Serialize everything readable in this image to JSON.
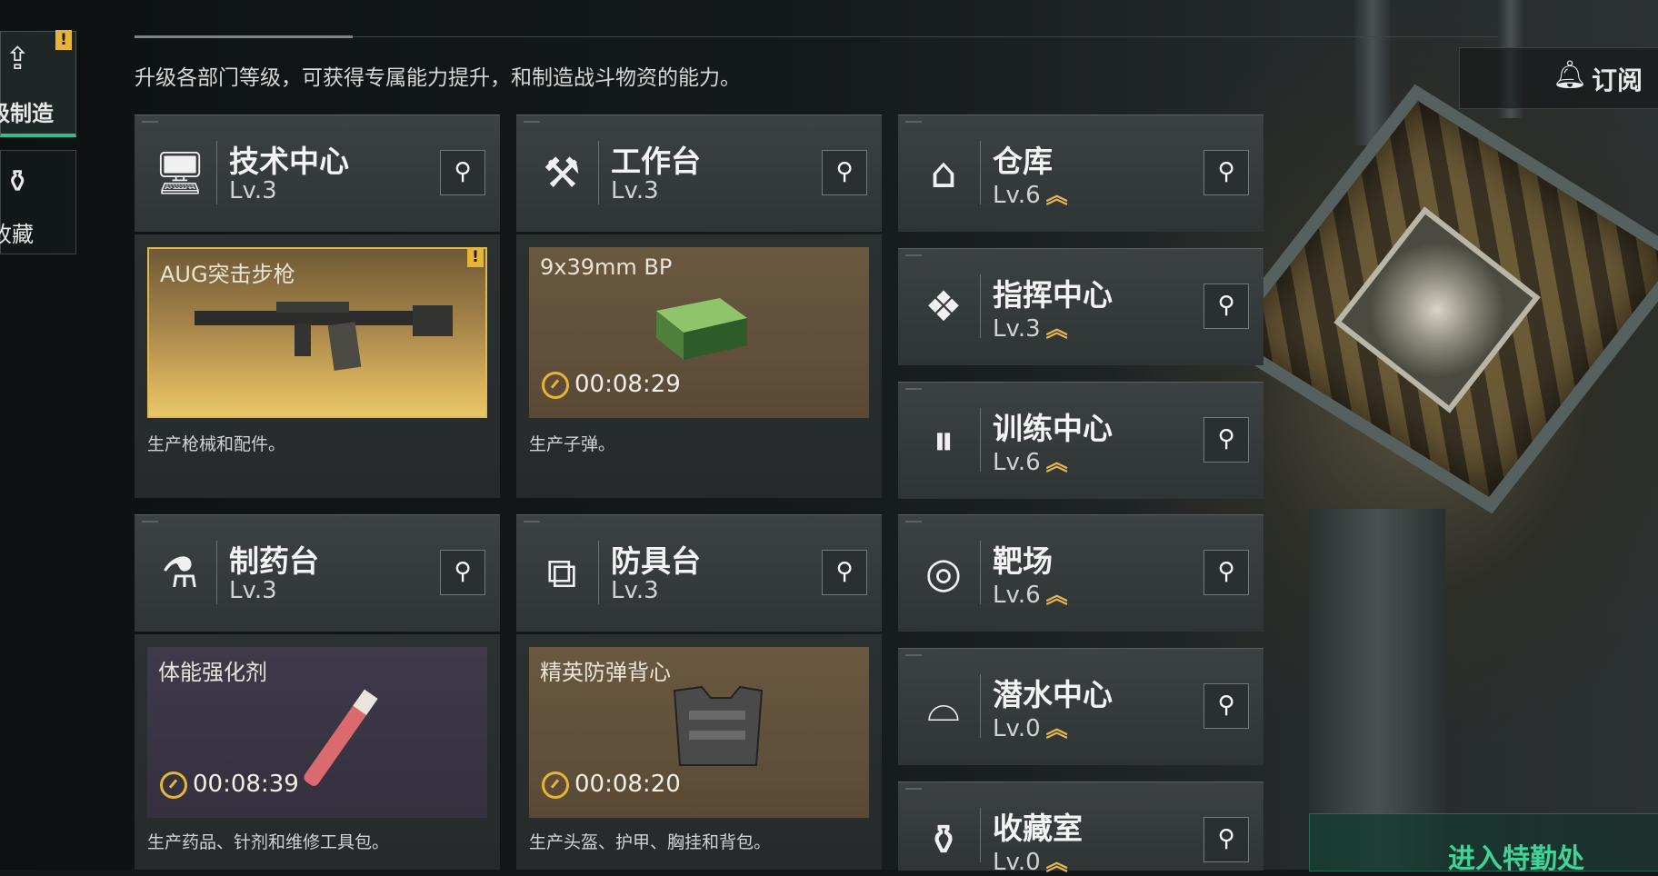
{
  "sidebar": {
    "items": [
      {
        "label": "级制造",
        "icon": "upgrade-icon",
        "active": true
      },
      {
        "label": "收藏",
        "icon": "collection-icon",
        "active": false
      }
    ]
  },
  "header": {
    "description": "升级各部门等级，可获得专属能力提升，和制造战斗物资的能力。",
    "subscribe_label": "订阅"
  },
  "alert_mark": "!",
  "departments": {
    "tech_center": {
      "name": "技术中心",
      "level": "Lv.3",
      "icon": "monitor-icon"
    },
    "workbench": {
      "name": "工作台",
      "level": "Lv.3",
      "icon": "hammer-wrench-icon"
    },
    "warehouse": {
      "name": "仓库",
      "level": "Lv.6",
      "icon": "warehouse-icon"
    },
    "command_center": {
      "name": "指挥中心",
      "level": "Lv.3",
      "icon": "command-icon"
    },
    "training_center": {
      "name": "训练中心",
      "level": "Lv.6",
      "icon": "dumbbell-icon"
    },
    "shooting_range": {
      "name": "靶场",
      "level": "Lv.6",
      "icon": "target-icon"
    },
    "pharmacy": {
      "name": "制药台",
      "level": "Lv.3",
      "icon": "microscope-icon"
    },
    "armor_bench": {
      "name": "防具台",
      "level": "Lv.3",
      "icon": "cubes-icon"
    },
    "diving_center": {
      "name": "潜水中心",
      "level": "Lv.0",
      "icon": "diving-mask-icon"
    },
    "collection_room": {
      "name": "收藏室",
      "level": "Lv.0",
      "icon": "trophy-case-icon"
    }
  },
  "production": {
    "tech_center": {
      "item": "AUG突击步枪",
      "timer": "",
      "desc": "生产枪械和配件。"
    },
    "workbench": {
      "item": "9x39mm BP",
      "timer": "00:08:29",
      "desc": "生产子弹。"
    },
    "pharmacy": {
      "item": "体能强化剂",
      "timer": "00:08:39",
      "desc": "生产药品、针剂和维修工具包。"
    },
    "armor_bench": {
      "item": "精英防弹背心",
      "timer": "00:08:20",
      "desc": "生产头盔、护甲、胸挂和背包。"
    }
  },
  "footer": {
    "enter_button": "进入特勤处"
  },
  "colors": {
    "accent_green": "#2fbf8a",
    "upgrade_gold": "#e5b84a",
    "alert_yellow": "#e7b43a"
  }
}
